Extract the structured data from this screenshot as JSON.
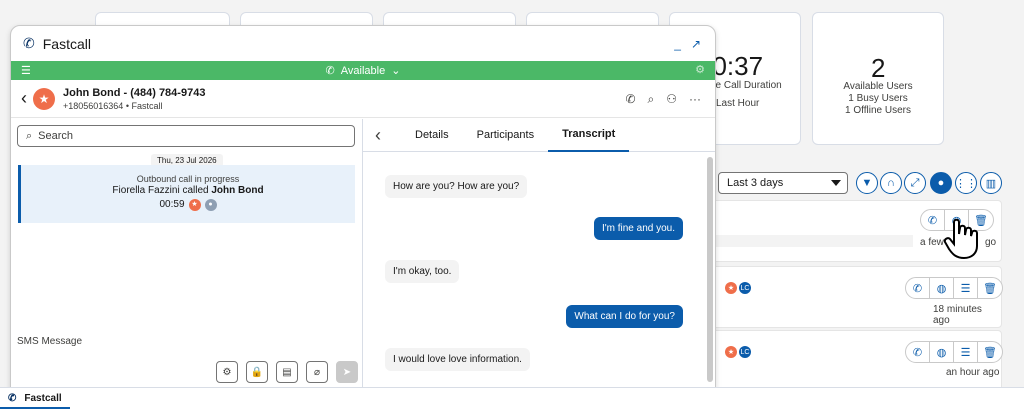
{
  "app_title": "Fastcall",
  "window_controls": {
    "minimize": "_",
    "popout": "↗"
  },
  "status_bar": {
    "status": "Available"
  },
  "contact": {
    "name_phone": "John Bond - (484) 784-9743",
    "sub": "+18056016364 • Fastcall"
  },
  "search": {
    "placeholder": "Search"
  },
  "thread": {
    "date": "Thu, 23 Jul 2026",
    "status": "Outbound call in progress",
    "caller": "Fiorella Fazzini called",
    "callee": "John Bond",
    "duration": "00:59"
  },
  "sms": {
    "placeholder": "SMS Message"
  },
  "tabs": [
    {
      "label": "Details"
    },
    {
      "label": "Participants"
    },
    {
      "label": "Transcript"
    }
  ],
  "transcript": [
    {
      "dir": "in",
      "text": "How are you? How are you?"
    },
    {
      "dir": "out",
      "text": "I'm fine and you."
    },
    {
      "dir": "in",
      "text": "I'm okay, too."
    },
    {
      "dir": "out",
      "text": "What can I do for you?"
    },
    {
      "dir": "in",
      "text": "I would love love information."
    }
  ],
  "dashboard": {
    "avg_duration_value": "00:37",
    "avg_duration_label": "ge Call Duration",
    "avg_duration_period": "Last Hour",
    "users_count": "2",
    "users_lines": [
      "Available Users",
      "1 Busy Users",
      "1 Offline Users"
    ],
    "range_filter": "Last 3 days",
    "activity_times": [
      "a few s",
      "go",
      "18 minutes ago",
      "an hour ago"
    ],
    "avatar_initials": "LC"
  },
  "bottom_tab": "Fastcall",
  "colors": {
    "green": "#4bb867",
    "brand": "#0b5cab",
    "avatar": "#ef6e4a"
  }
}
